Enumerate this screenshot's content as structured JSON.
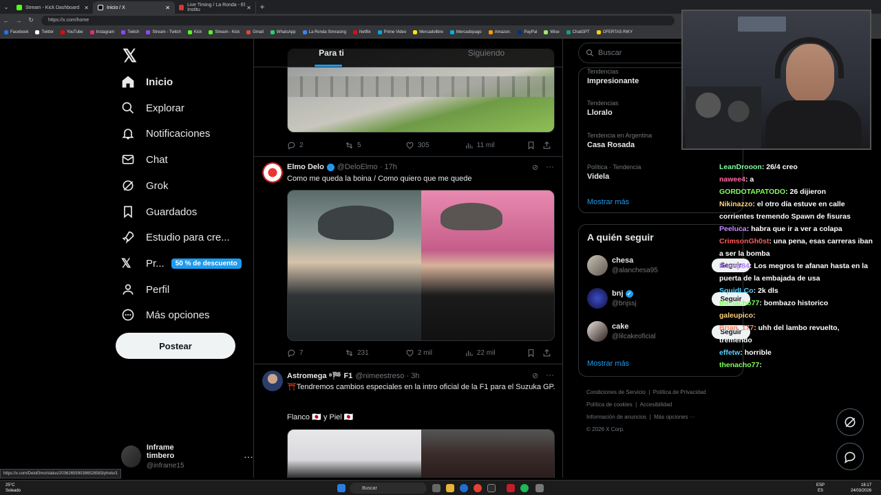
{
  "browser": {
    "tabs": [
      {
        "label": "Stream - Kick Dashboard",
        "color": "#53fc18"
      },
      {
        "label": "Inicio / X",
        "color": "#ffffff"
      },
      {
        "label": "Live Timing / La Ronda - El Institu",
        "color": "#d33"
      }
    ],
    "url": "https://x.com/home",
    "bookmarks": [
      "Facebook",
      "Twitter",
      "YouTube",
      "Instagram",
      "Twitch",
      "Stream - Twitch",
      "Kick",
      "Stream - Kick",
      "Gmail",
      "WhatsApp",
      "La Ronda Simracing",
      "Netflix",
      "Prime Video",
      "Mercadolibre",
      "Mercadopago",
      "Amazon.",
      "PayPal",
      "Wise",
      "ChatGPT",
      "OFERTAS RIKY"
    ],
    "status_url": "https://x.com/DeloElmo/status/2036265590386528583/photo/1"
  },
  "nav": {
    "items": [
      "Inicio",
      "Explorar",
      "Notificaciones",
      "Chat",
      "Grok",
      "Guardados",
      "Estudio para cre...",
      "Pr...",
      "Perfil",
      "Más opciones"
    ],
    "badge": "50 % de descuento",
    "post_label": "Postear",
    "account_name": "Inframe timbero",
    "account_handle": "@inframe15",
    "more_dots": "···"
  },
  "feed": {
    "tabs": [
      "Para ti",
      "Siguiendo"
    ],
    "tweet0": {
      "reply": "2",
      "retweet": "5",
      "like": "305",
      "views": "11 mil"
    },
    "tweet1": {
      "name": "Elmo Delo",
      "handle": "@DeloElmo",
      "time": "· 17h",
      "text": "Como me queda la boina / Como quiero que me quede",
      "reply": "7",
      "retweet": "231",
      "like": "2 mil",
      "views": "22 mil"
    },
    "tweet2": {
      "name": "Astromega ⁸🏁 F1",
      "handle": "@nimeestreso",
      "time": "· 3h",
      "text": "⛩️Tendremos cambios especiales en la intro oficial de la F1 para el Suzuka GP.",
      "text2": "Flanco 🇯🇵 y Piel 🇯🇵"
    }
  },
  "right": {
    "search_placeholder": "Buscar",
    "trends": [
      {
        "category": "Tendencias",
        "title": "Impresionante"
      },
      {
        "category": "Tendencias",
        "title": "Lloralo"
      },
      {
        "category": "Tendencia en Argentina",
        "title": "Casa Rosada"
      },
      {
        "category": "Política · Tendencia",
        "title": "Videla"
      }
    ],
    "show_more": "Mostrar más",
    "follow_title": "A quién seguir",
    "follow": [
      {
        "name": "chesa",
        "handle": "@alanchesa95"
      },
      {
        "name": "bnj",
        "handle": "@bnjssj"
      },
      {
        "name": "cake",
        "handle": "@lilcakeoficial"
      }
    ],
    "follow_btn": "Seguir",
    "footer": [
      "Condiciones de Servicio",
      "Política de Privacidad",
      "Política de cookies",
      "Accesibilidad",
      "Información de anuncios",
      "Más opciones ···",
      "© 2026 X Corp."
    ]
  },
  "chat": [
    {
      "user": "LeanDrooon",
      "color": "#7fffa0",
      "msg": ": 26/4 creo"
    },
    {
      "user": "nawee4",
      "color": "#ff6b9d",
      "msg": ": a"
    },
    {
      "user": "GORDOTAPATODO",
      "color": "#7fff5a",
      "msg": ": 26 dijieron"
    },
    {
      "user": "Nikinazzo",
      "color": "#ffd27f",
      "msg": ": el otro día estuve en calle corrientes tremendo Spawn de fisuras"
    },
    {
      "user": "Peeluca",
      "color": "#c58bff",
      "msg": ": habra que ir a ver a colapa"
    },
    {
      "user": "CrimsonGh0st",
      "color": "#ff5a5a",
      "msg": ": una pena, esas carreras iban a ser la bomba"
    },
    {
      "user": "Framp84",
      "color": "#b77bff",
      "msg": ": Los megros te afanan hasta en la puerta de la embajada de usa"
    },
    {
      "user": "SquidLCo",
      "color": "#5ad1ff",
      "msg": ": 2k dls"
    },
    {
      "user": "thenacho77",
      "color": "#7fff5a",
      "msg": ": bombazo historico"
    },
    {
      "user": "galeupico",
      "color": "#ffd27f",
      "msg": ": "
    },
    {
      "user": "Brian_177",
      "color": "#ff7f5a",
      "msg": ": uhh del lambo revuelto, tremendo"
    },
    {
      "user": "effetw",
      "color": "#5ad1ff",
      "msg": ": horrible"
    },
    {
      "user": "thenacho77",
      "color": "#7fff5a",
      "msg": ": "
    }
  ],
  "taskbar": {
    "weather_temp": "25°C",
    "weather_desc": "Soleado",
    "search": "Buscar",
    "lang": "ESP",
    "lang2": "ES",
    "time": "16:17",
    "date": "24/03/2026"
  }
}
